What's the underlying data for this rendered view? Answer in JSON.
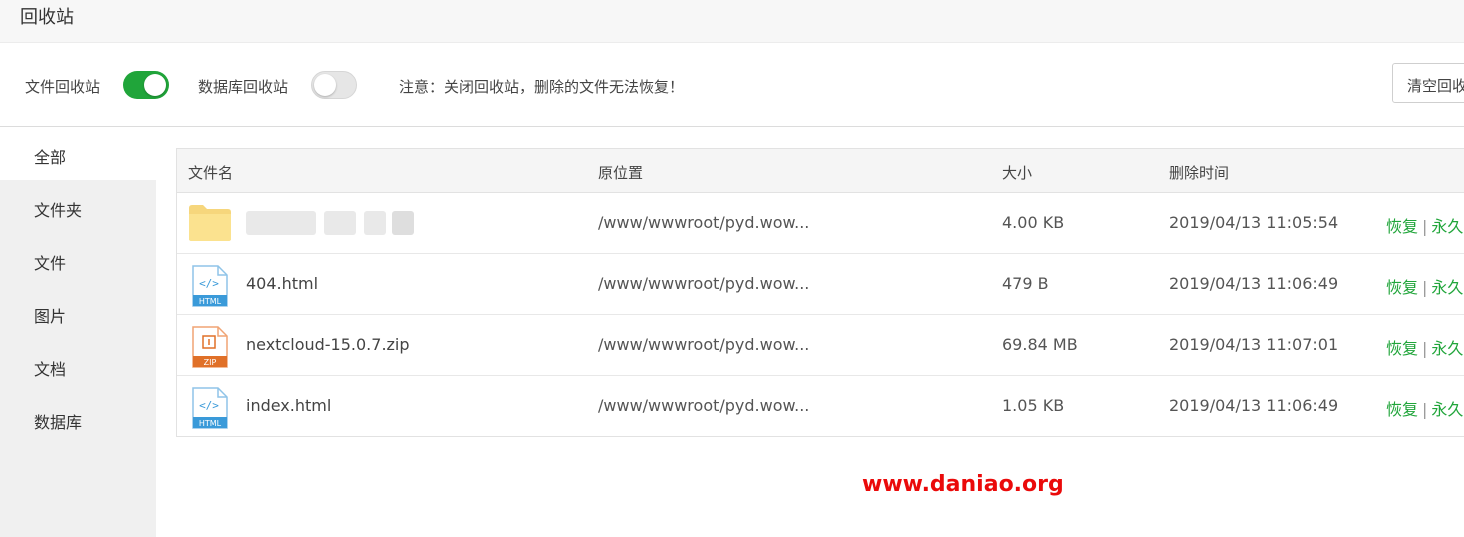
{
  "window": {
    "title": "回收站"
  },
  "toolbar": {
    "file_recycle_label": "文件回收站",
    "file_recycle_on": true,
    "db_recycle_label": "数据库回收站",
    "db_recycle_on": false,
    "notice": "注意：关闭回收站，删除的文件无法恢复！",
    "clear_button": "清空回收站"
  },
  "sidebar": {
    "items": [
      {
        "label": "全部",
        "active": true
      },
      {
        "label": "文件夹"
      },
      {
        "label": "文件"
      },
      {
        "label": "图片"
      },
      {
        "label": "文档"
      },
      {
        "label": "数据库"
      }
    ]
  },
  "table": {
    "headers": [
      "文件名",
      "原位置",
      "大小",
      "删除时间"
    ],
    "rows": [
      {
        "icon": "folder-icon",
        "name": "",
        "path": "/www/wwwroot/pyd.wow...",
        "size": "4.00 KB",
        "time": "2019/04/13 11:05:54"
      },
      {
        "icon": "html-file-icon",
        "name": "404.html",
        "path": "/www/wwwroot/pyd.wow...",
        "size": "479 B",
        "time": "2019/04/13 11:06:49"
      },
      {
        "icon": "zip-file-icon",
        "name": "nextcloud-15.0.7.zip",
        "path": "/www/wwwroot/pyd.wow...",
        "size": "69.84 MB",
        "time": "2019/04/13 11:07:01"
      },
      {
        "icon": "html-file-icon",
        "name": "index.html",
        "path": "/www/wwwroot/pyd.wow...",
        "size": "1.05 KB",
        "time": "2019/04/13 11:06:49"
      }
    ],
    "restore_label": "恢复",
    "delete_label": "永久删除"
  },
  "watermark": "www.daniao.org",
  "colors": {
    "accent": "#20a53a",
    "watermark": "#ea0a0a"
  }
}
